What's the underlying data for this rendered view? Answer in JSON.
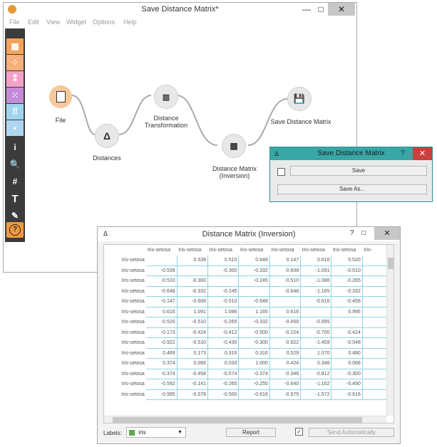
{
  "main_window": {
    "title": "Save Distance Matrix*",
    "controls": {
      "minimize": "—",
      "maximize": "□",
      "close": "✕"
    },
    "menu": [
      "File",
      "Edit",
      "View",
      "Widget",
      "Options",
      "Help"
    ]
  },
  "toolbar": {
    "categories": [
      "data-icon",
      "visualize-icon",
      "model-icon",
      "evaluate-icon",
      "unsupervised-icon",
      "add-ons-icon"
    ],
    "tools": [
      {
        "name": "info-tool",
        "glyph": "i"
      },
      {
        "name": "zoom-tool",
        "glyph": "🔍"
      },
      {
        "name": "grid-tool",
        "glyph": "#"
      },
      {
        "name": "text-tool",
        "glyph": "T"
      },
      {
        "name": "pen-tool",
        "glyph": "✎"
      },
      {
        "name": "pause-tool",
        "glyph": "❚❚"
      },
      {
        "name": "help-tool",
        "glyph": "?"
      }
    ]
  },
  "canvas": {
    "nodes": [
      {
        "id": "file",
        "label": "File",
        "color": "#f6c89a"
      },
      {
        "id": "distances",
        "label": "Distances",
        "color": "#e8e8e8"
      },
      {
        "id": "distance-transformation",
        "label": "Distance\nTransformation",
        "color": "#e8e8e8"
      },
      {
        "id": "distance-matrix",
        "label": "Distance Matrix\n(Inversion)",
        "color": "#e8e8e8"
      },
      {
        "id": "save-distance-matrix",
        "label": "Save Distance Matrix",
        "color": "#e8e8e8"
      }
    ]
  },
  "save_dialog": {
    "title": "Save Distance Matrix",
    "help": "?",
    "close": "✕",
    "save_label": "Save",
    "save_as_label": "Save As..."
  },
  "dm_window": {
    "title": "Distance Matrix (Inversion)",
    "controls": {
      "help": "?",
      "maximize": "□",
      "close": "✕"
    },
    "columns": [
      "Iris-setosa",
      "Iris-setosa",
      "Iris-setosa",
      "Iris-setosa",
      "Iris-setosa",
      "Iris-setosa",
      "Iris-setosa",
      "Iris-"
    ],
    "rows": [
      {
        "label": "Iris-setosa",
        "cells": [
          "",
          "0.539",
          "0.510",
          "0.648",
          "0.147",
          "0.616",
          "0.520",
          ""
        ]
      },
      {
        "label": "Iris-setosa",
        "cells": [
          "-0.539",
          "",
          "-0.300",
          "-0.332",
          "-0.608",
          "-1.091",
          "-0.510",
          ""
        ]
      },
      {
        "label": "Iris-setosa",
        "cells": [
          "-0.510",
          "-0.300",
          "",
          "-0.245",
          "-0.510",
          "-1.086",
          "-0.265",
          ""
        ]
      },
      {
        "label": "Iris-setosa",
        "cells": [
          "-0.648",
          "-0.332",
          "-0.245",
          "",
          "-0.648",
          "-1.165",
          "-0.332",
          ""
        ]
      },
      {
        "label": "Iris-setosa",
        "cells": [
          "-0.147",
          "-0.608",
          "-0.510",
          "-0.648",
          "",
          "-0.616",
          "-0.458",
          ""
        ]
      },
      {
        "label": "Iris-setosa",
        "cells": [
          "0.616",
          "1.091",
          "1.086",
          "1.165",
          "0.616",
          "",
          "0.995",
          ""
        ]
      },
      {
        "label": "Iris-setosa",
        "cells": [
          "-0.520",
          "-0.510",
          "-0.265",
          "-0.332",
          "-0.458",
          "-0.995",
          "",
          ""
        ]
      },
      {
        "label": "Iris-setosa",
        "cells": [
          "-0.173",
          "-0.424",
          "-0.412",
          "-0.500",
          "-0.224",
          "-0.700",
          "-0.424",
          ""
        ]
      },
      {
        "label": "Iris-setosa",
        "cells": [
          "-0.922",
          "-0.510",
          "-0.430",
          "-0.300",
          "-0.922",
          "-1.459",
          "-0.548",
          ""
        ]
      },
      {
        "label": "Iris-setosa",
        "cells": [
          "0.469",
          "0.173",
          "0.316",
          "0.316",
          "0.529",
          "1.070",
          "0.480",
          ""
        ]
      },
      {
        "label": "Iris-setosa",
        "cells": [
          "0.374",
          "0.066",
          "0.033",
          "1.000",
          "0.424",
          "0.346",
          "0.066",
          ""
        ]
      },
      {
        "label": "Iris-setosa",
        "cells": [
          "-0.374",
          "-0.458",
          "-0.574",
          "-0.374",
          "-0.346",
          "-0.812",
          "-0.300",
          ""
        ]
      },
      {
        "label": "Iris-setosa",
        "cells": [
          "-0.592",
          "-0.141",
          "-0.265",
          "-0.255",
          "-0.640",
          "-1.162",
          "-0.490",
          ""
        ]
      },
      {
        "label": "Iris-setosa",
        "cells": [
          "-0.995",
          "-0.578",
          "-0.500",
          "-0.616",
          "-0.975",
          "-1.572",
          "-0.616",
          ""
        ]
      }
    ],
    "labels_caption": "Labels:",
    "labels_value": "iris",
    "report_label": "Report",
    "send_auto_label": "Send Automatically"
  },
  "colors": {
    "accent": "#39a7a5",
    "grid": "#8fd3ea",
    "close_red": "#c9403c"
  }
}
